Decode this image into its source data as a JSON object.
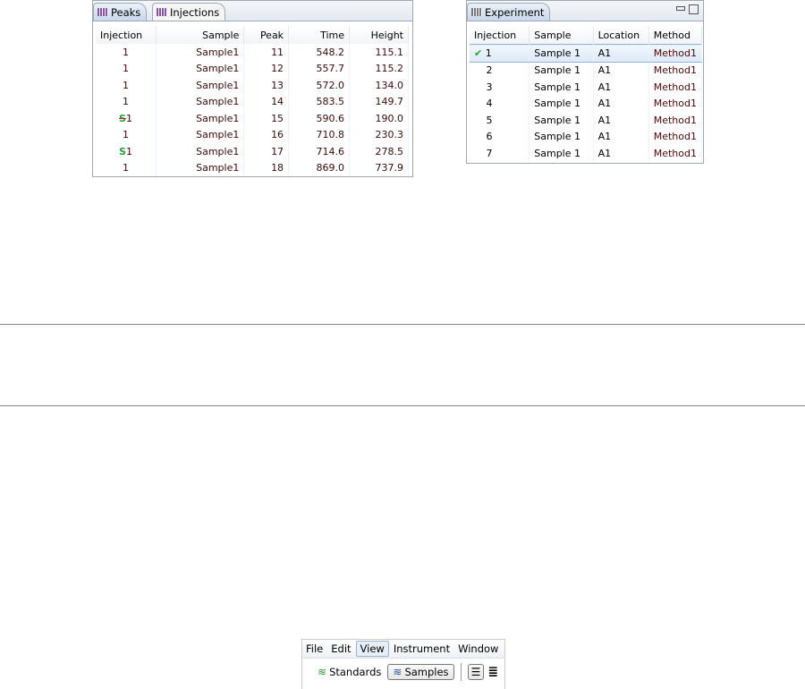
{
  "peaks_panel": {
    "tabs": [
      {
        "label": "Peaks",
        "icon": "grid-icon"
      },
      {
        "label": "Injections",
        "icon": "grid-icon"
      }
    ],
    "columns": [
      "Injection",
      "Sample",
      "Peak",
      "Time",
      "Height"
    ],
    "rows": [
      {
        "marker": "",
        "injection": "1",
        "sample": "Sample1",
        "peak": "11",
        "time": "548.2",
        "height": "115.1"
      },
      {
        "marker": "",
        "injection": "1",
        "sample": "Sample1",
        "peak": "12",
        "time": "557.7",
        "height": "115.2"
      },
      {
        "marker": "",
        "injection": "1",
        "sample": "Sample1",
        "peak": "13",
        "time": "572.0",
        "height": "134.0"
      },
      {
        "marker": "",
        "injection": "1",
        "sample": "Sample1",
        "peak": "14",
        "time": "583.5",
        "height": "149.7"
      },
      {
        "marker": "standard-removed",
        "injection": "1",
        "sample": "Sample1",
        "peak": "15",
        "time": "590.6",
        "height": "190.0"
      },
      {
        "marker": "",
        "injection": "1",
        "sample": "Sample1",
        "peak": "16",
        "time": "710.8",
        "height": "230.3"
      },
      {
        "marker": "standard",
        "injection": "1",
        "sample": "Sample1",
        "peak": "17",
        "time": "714.6",
        "height": "278.5"
      },
      {
        "marker": "",
        "injection": "1",
        "sample": "Sample1",
        "peak": "18",
        "time": "869.0",
        "height": "737.9"
      }
    ]
  },
  "experiment_panel": {
    "tab": "Experiment",
    "columns": [
      "Injection",
      "Sample",
      "Location",
      "Method"
    ],
    "rows": [
      {
        "injection": "1",
        "sample": "Sample 1",
        "location": "A1",
        "method": "Method1",
        "selected": true
      },
      {
        "injection": "2",
        "sample": "Sample 1",
        "location": "A1",
        "method": "Method1"
      },
      {
        "injection": "3",
        "sample": "Sample 1",
        "location": "A1",
        "method": "Method1"
      },
      {
        "injection": "4",
        "sample": "Sample 1",
        "location": "A1",
        "method": "Method1"
      },
      {
        "injection": "5",
        "sample": "Sample 1",
        "location": "A1",
        "method": "Method1"
      },
      {
        "injection": "6",
        "sample": "Sample 1",
        "location": "A1",
        "method": "Method1"
      },
      {
        "injection": "7",
        "sample": "Sample 1",
        "location": "A1",
        "method": "Method1"
      }
    ]
  },
  "toolbar": {
    "menus": [
      "File",
      "Edit",
      "View",
      "Instrument",
      "Window"
    ],
    "active_menu": "View",
    "standards_label": "Standards",
    "samples_label": "Samples"
  },
  "colors": {
    "marker_green": "#2a9d3a",
    "marker_red": "#d92020",
    "method_text": "#4a0a0a"
  }
}
